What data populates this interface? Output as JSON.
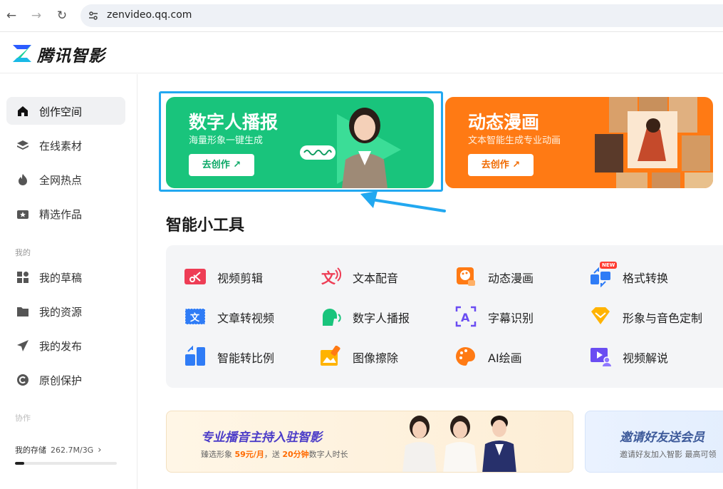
{
  "browser": {
    "url": "zenvideo.qq.com"
  },
  "app": {
    "brand": "腾讯智影"
  },
  "sidebar": {
    "items": [
      {
        "label": "创作空间",
        "icon": "home-icon",
        "active": true
      },
      {
        "label": "在线素材",
        "icon": "layers-icon"
      },
      {
        "label": "全网热点",
        "icon": "flame-icon"
      },
      {
        "label": "精选作品",
        "icon": "video-star-icon"
      }
    ],
    "group_mine": "我的",
    "mine_items": [
      {
        "label": "我的草稿",
        "icon": "grid-icon"
      },
      {
        "label": "我的资源",
        "icon": "folder-icon"
      },
      {
        "label": "我的发布",
        "icon": "send-icon"
      },
      {
        "label": "原创保护",
        "icon": "copyright-icon"
      }
    ],
    "group_collab": "协作",
    "storage_label": "我的存储",
    "storage_value": "262.7M/3G",
    "storage_fraction": 0.09
  },
  "banners": [
    {
      "title": "数字人播报",
      "subtitle": "海量形象一键生成",
      "button": "去创作 ↗",
      "color": "#19c47c"
    },
    {
      "title": "动态漫画",
      "subtitle": "文本智能生成专业动画",
      "button": "去创作 ↗",
      "color": "#ff7a14"
    }
  ],
  "tools_title": "智能小工具",
  "tools": [
    {
      "label": "视频剪辑",
      "icon": "scissors-icon"
    },
    {
      "label": "文本配音",
      "icon": "text-voice-icon"
    },
    {
      "label": "动态漫画",
      "icon": "palette-comic-icon"
    },
    {
      "label": "格式转换",
      "icon": "convert-icon",
      "badge": "NEW"
    },
    {
      "label": "文章转视频",
      "icon": "article-video-icon"
    },
    {
      "label": "数字人播报",
      "icon": "avatar-voice-icon"
    },
    {
      "label": "字幕识别",
      "icon": "subtitle-icon"
    },
    {
      "label": "形象与音色定制",
      "icon": "diamond-icon"
    },
    {
      "label": "智能转比例",
      "icon": "ratio-icon"
    },
    {
      "label": "图像擦除",
      "icon": "eraser-icon"
    },
    {
      "label": "AI绘画",
      "icon": "paint-palette-icon"
    },
    {
      "label": "视频解说",
      "icon": "video-narrate-icon"
    }
  ],
  "promos": [
    {
      "title": "专业播音主持入驻智影",
      "sub_pre": "臻选形象 ",
      "sub_hl1": "59元/月",
      "sub_mid": "，送 ",
      "sub_hl2": "20分钟",
      "sub_post": "数字人时长"
    },
    {
      "title": "邀请好友送会员",
      "sub": "邀请好友加入智影 最高可领"
    }
  ]
}
